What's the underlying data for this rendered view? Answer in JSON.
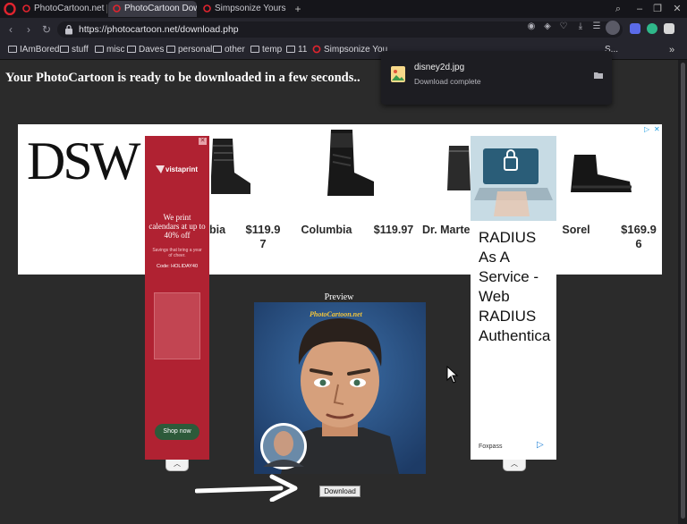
{
  "browser": {
    "tabs": [
      {
        "title": "PhotoCartoon.net | P",
        "active": false
      },
      {
        "title": "PhotoCartoon Down",
        "active": true
      },
      {
        "title": "Simpsonize Yourself |",
        "active": false
      }
    ],
    "new_tab": "+",
    "window_controls": {
      "search": "⌕",
      "minimize": "–",
      "restore": "❐",
      "close": "✕"
    },
    "nav": {
      "back": "‹",
      "forward": "›",
      "reload": "↻"
    },
    "url": "https://photocartoon.net/download.php",
    "bookmarks": [
      {
        "label": "IAmBored",
        "type": "folder"
      },
      {
        "label": "stuff",
        "type": "folder"
      },
      {
        "label": "misc",
        "type": "folder"
      },
      {
        "label": "Daves",
        "type": "folder"
      },
      {
        "label": "personal",
        "type": "folder"
      },
      {
        "label": "other",
        "type": "folder"
      },
      {
        "label": "temp",
        "type": "folder"
      },
      {
        "label": "11",
        "type": "folder"
      },
      {
        "label": "Simpsonize You",
        "type": "site"
      },
      {
        "label": "S...",
        "type": "site"
      }
    ],
    "bookmarks_more": "»"
  },
  "download_popup": {
    "filename": "disney2d.jpg",
    "status": "Download complete"
  },
  "page": {
    "headline": "Your PhotoCartoon is ready to be downloaded in a few seconds..",
    "preview_label": "Preview",
    "download_button": "Download",
    "preview_watermark": "PhotoCartoon.net"
  },
  "banner_ad": {
    "brand": "DSW",
    "adchoices": "▷ ✕",
    "products": [
      {
        "name": "bia",
        "price": "$119.9\n7"
      },
      {
        "name": "Columbia",
        "price": "$119.97"
      },
      {
        "name": "Dr. Marte",
        "price": ""
      },
      {
        "name": "Sorel",
        "price": "$169.9\n6"
      }
    ]
  },
  "left_ad": {
    "brand": "vistaprint",
    "title": "We print calendars at up to 40% off",
    "subtitle": "Savings that bring a year of cheer.",
    "code": "Code: HOLIDAY40",
    "cta": "Shop now",
    "close": "✕",
    "collapse": "︿"
  },
  "right_ad": {
    "lines": [
      "RADIUS",
      "As A",
      "Service -",
      "Web",
      "RADIUS",
      "Authentica"
    ],
    "brand": "Foxpass",
    "arrow": "▷",
    "collapse": "︿"
  },
  "colors": {
    "browser_bg": "#15151a",
    "page_bg": "#2b2b2b",
    "vistaprint_red": "#b02232",
    "opera_red": "#e0242e",
    "link_blue": "#1d7fd6"
  }
}
